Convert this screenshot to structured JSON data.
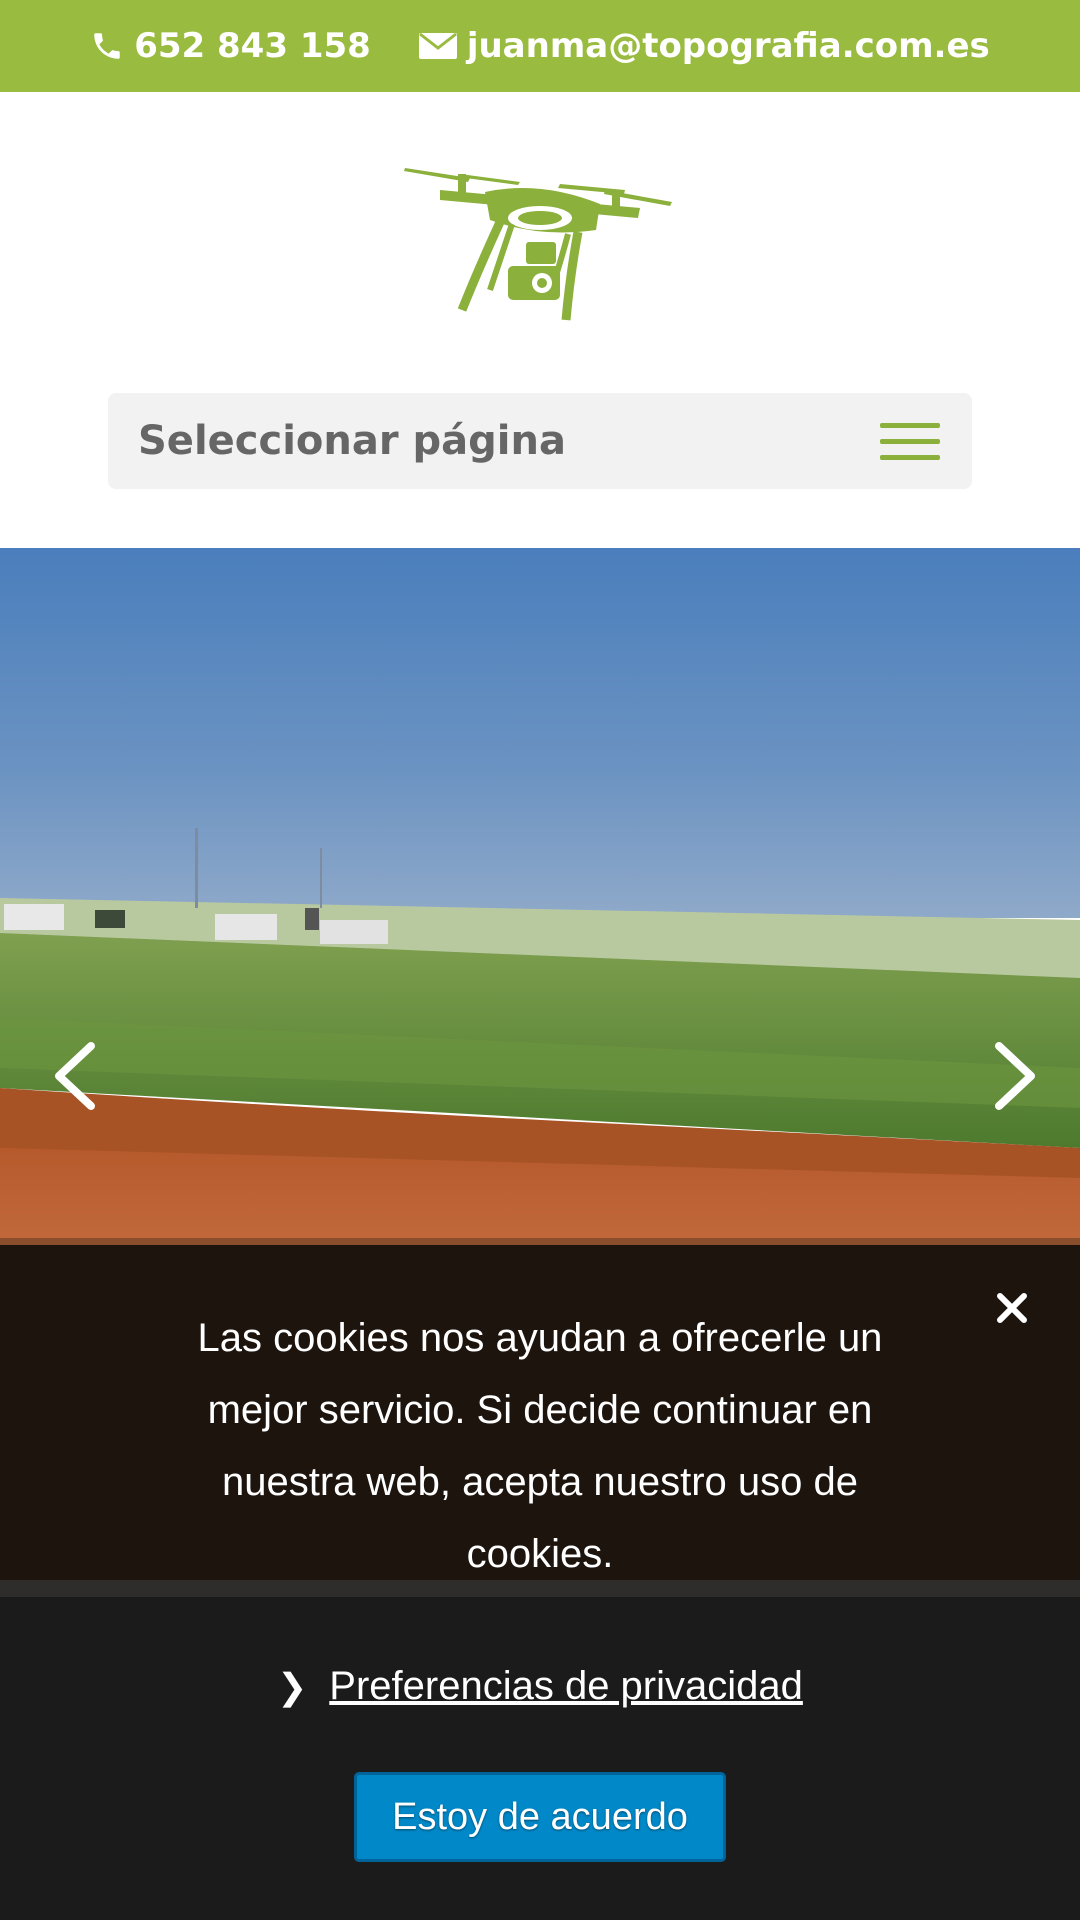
{
  "topbar": {
    "phone": "652 843 158",
    "phone_icon": "phone-icon",
    "email": "juanma@topografia.com.es",
    "email_icon": "envelope-icon",
    "background": "#99bb40"
  },
  "header": {
    "logo_icon": "drone-icon",
    "logo_color": "#8bb03b"
  },
  "nav": {
    "select_label": "Seleccionar página",
    "menu_icon": "hamburger-icon"
  },
  "slider": {
    "prev_icon": "chevron-left-icon",
    "next_icon": "chevron-right-icon"
  },
  "cookie": {
    "text": "Las cookies nos ayudan a ofrecerle un mejor servicio. Si decide continuar en nuestra web, acepta nuestro uso de cookies.",
    "close_icon": "close-icon",
    "privacy_chevron": "❯",
    "privacy_label": "Preferencias de privacidad",
    "accept_label": "Estoy de acuerdo",
    "accept_color": "#0088c8"
  }
}
